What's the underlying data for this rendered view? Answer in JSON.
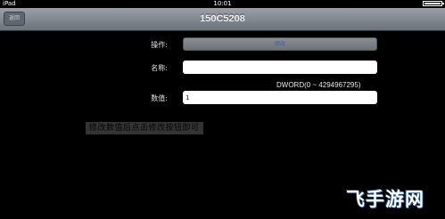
{
  "status": {
    "device": "iPad",
    "time": "10:01"
  },
  "navbar": {
    "back_label": "返回",
    "title": "150C5208"
  },
  "form": {
    "operation_label": "操作:",
    "operation_button": "修改",
    "name_label": "名称:",
    "name_value": "",
    "type_hint": "DWORD(0 ~ 4294967295)",
    "value_label": "数值:",
    "value_value": "1"
  },
  "caption": "修改数值后点击修改按钮即可",
  "watermark": "飞手游网"
}
